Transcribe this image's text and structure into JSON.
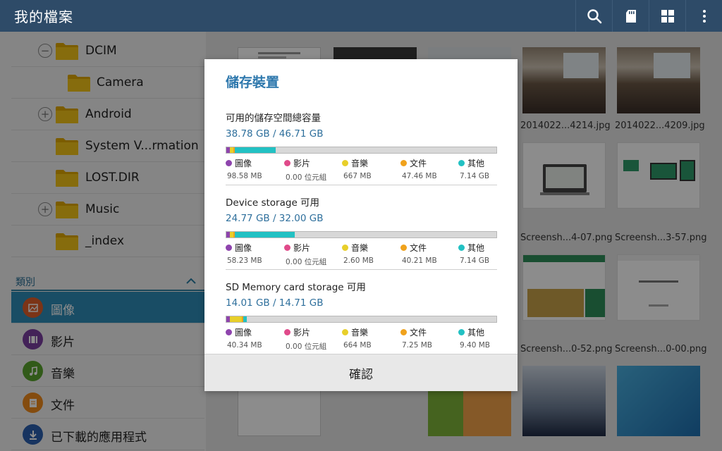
{
  "app": {
    "title": "我的檔案"
  },
  "colors": {
    "actionbar": "#2e4b68",
    "selected": "#2e8db8",
    "dialog_title": "#2e78ad",
    "folder": "#f5c518",
    "images": "#8e44ad",
    "videos": "#e04a8a",
    "music": "#e8cf2a",
    "documents": "#f0a21c",
    "others": "#22c1c3"
  },
  "actionbar_icons": [
    "search-icon",
    "sd-card-icon",
    "grid-view-icon",
    "more-vert-icon"
  ],
  "folders": [
    {
      "label": "DCIM",
      "expander": "−"
    },
    {
      "label": "Camera",
      "expander": ""
    },
    {
      "label": "Android",
      "expander": "+"
    },
    {
      "label": "System V...rmation",
      "expander": ""
    },
    {
      "label": "LOST.DIR",
      "expander": ""
    },
    {
      "label": "Music",
      "expander": "+"
    },
    {
      "label": "_index",
      "expander": ""
    }
  ],
  "categories": {
    "header": "類別",
    "items": [
      {
        "label": "圖像",
        "icon": "image-icon"
      },
      {
        "label": "影片",
        "icon": "video-icon"
      },
      {
        "label": "音樂",
        "icon": "music-icon"
      },
      {
        "label": "文件",
        "icon": "document-icon"
      },
      {
        "label": "已下載的應用程式",
        "icon": "download-icon"
      }
    ]
  },
  "thumbnails": {
    "captions": [
      "2014022...4214.jpg",
      "2014022...4209.jpg",
      "Screensh...4-07.png",
      "Screensh...3-57.png",
      "Screensh...0-52.png",
      "Screensh...0-00.png"
    ]
  },
  "dialog": {
    "title": "儲存裝置",
    "button": "確認",
    "legend_labels": [
      "圖像",
      "影片",
      "音樂",
      "文件",
      "其他"
    ],
    "sections": [
      {
        "name": "可用的儲存空間總容量",
        "value": "38.78 GB / 46.71 GB",
        "sizes": [
          "98.58 MB",
          "0.00 位元組",
          "667 MB",
          "47.46 MB",
          "7.14 GB"
        ],
        "fractions": [
          0.012,
          0.0,
          0.014,
          0.006,
          0.15
        ]
      },
      {
        "name": "Device storage 可用",
        "value": "24.77 GB / 32.00 GB",
        "sizes": [
          "58.23 MB",
          "0.00 位元組",
          "2.60 MB",
          "40.21 MB",
          "7.14 GB"
        ],
        "fractions": [
          0.012,
          0.0,
          0.014,
          0.006,
          0.22
        ]
      },
      {
        "name": "SD Memory card storage 可用",
        "value": "14.01 GB / 14.71 GB",
        "sizes": [
          "40.34 MB",
          "0.00 位元組",
          "664 MB",
          "7.25 MB",
          "9.40 MB"
        ],
        "fractions": [
          0.012,
          0.0,
          0.045,
          0.005,
          0.013
        ]
      }
    ]
  }
}
